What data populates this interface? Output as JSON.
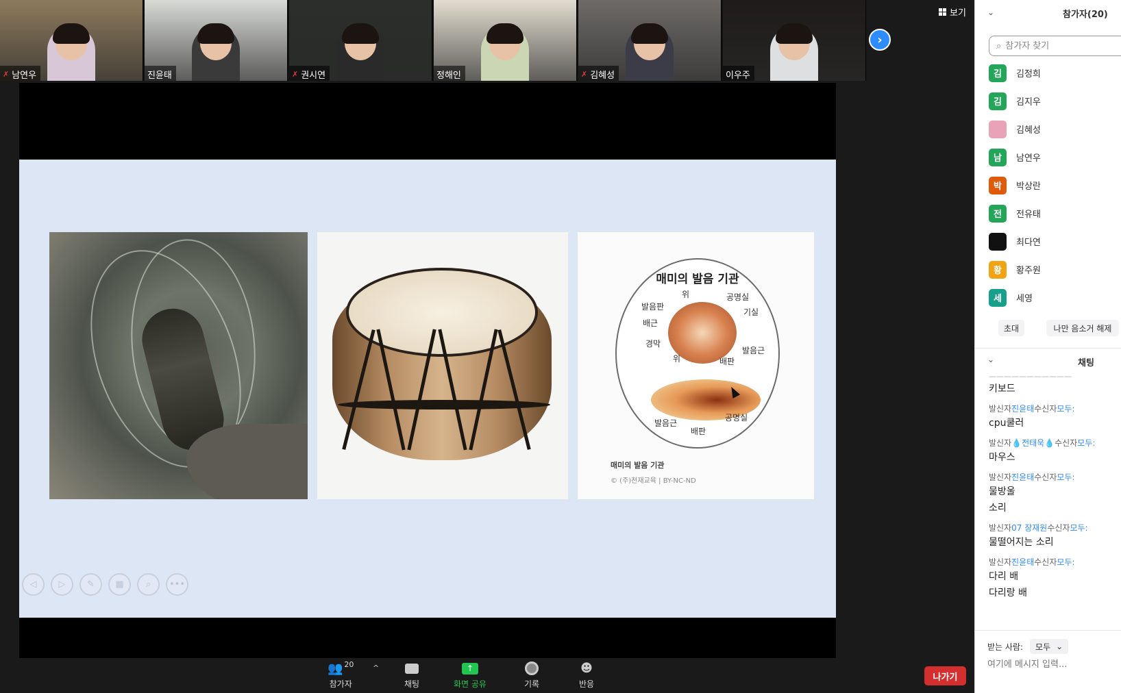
{
  "view": {
    "label": "보기"
  },
  "videos": [
    {
      "name": "남연우",
      "muted": true,
      "scene": "#8d7a5c",
      "shirt": "#d8c7d6"
    },
    {
      "name": "진윤태",
      "muted": false,
      "scene": "#d8dad6",
      "shirt": "#3a3a3a"
    },
    {
      "name": "권시연",
      "muted": true,
      "scene": "#2b2e2a",
      "shirt": "#2a2a2a"
    },
    {
      "name": "정해인",
      "muted": false,
      "scene": "#e2ddd0",
      "shirt": "#cbd7b4"
    },
    {
      "name": "김혜성",
      "muted": true,
      "scene": "#6d6a67",
      "shirt": "#3c3c48"
    },
    {
      "name": "이우주",
      "muted": false,
      "scene": "#1e1b19",
      "shirt": "#dedfe0"
    }
  ],
  "slide": {
    "diagram": {
      "title": "매미의 발음 기관",
      "labels": [
        "위",
        "공명실",
        "발음판",
        "기실",
        "배근",
        "경막",
        "발음근",
        "배판",
        "위",
        "발음근",
        "공명실",
        "배판"
      ],
      "caption": "매미의 발음 기관",
      "credit": "© (주)천재교육 | BY-NC-ND"
    },
    "controls": [
      "previous-icon",
      "next-icon",
      "pen-icon",
      "slides-icon",
      "zoom-icon",
      "more-icon"
    ]
  },
  "participants_panel": {
    "title": "참가자(20)",
    "search_placeholder": "참가자 찾기",
    "participants": [
      {
        "initial": "김",
        "name": "김정희",
        "color": "#23a55a"
      },
      {
        "initial": "김",
        "name": "김지우",
        "color": "#23a55a"
      },
      {
        "initial": "",
        "name": "김혜성",
        "color": "#e8a3b8"
      },
      {
        "initial": "남",
        "name": "남연우",
        "color": "#23a55a"
      },
      {
        "initial": "박",
        "name": "박상란",
        "color": "#e05a0c"
      },
      {
        "initial": "전",
        "name": "전유태",
        "color": "#23a55a"
      },
      {
        "initial": "",
        "name": "최다연",
        "color": "#111111"
      },
      {
        "initial": "황",
        "name": "황주원",
        "color": "#f0a314"
      },
      {
        "initial": "세",
        "name": "세영",
        "color": "#17a18a"
      }
    ],
    "invite_label": "초대",
    "unmute_me_label": "나만 음소거 해제"
  },
  "chat": {
    "title": "채팅",
    "messages": [
      {
        "sender": "",
        "lines": [
          "키보드"
        ]
      },
      {
        "sender": "진윤태",
        "lines": [
          "cpu쿨러"
        ]
      },
      {
        "sender": "💧전태욱💧",
        "lines": [
          "마우스"
        ]
      },
      {
        "sender": "진윤태",
        "lines": [
          "물방울",
          "소리"
        ]
      },
      {
        "sender": "07 장재원",
        "lines": [
          "물떨어지는 소리"
        ]
      },
      {
        "sender": "진윤태",
        "lines": [
          "다리 배",
          "다리랑 배"
        ]
      }
    ],
    "meta_from": "발신자",
    "meta_to": "수신자",
    "meta_everyone": "모두:",
    "to_label": "받는 사람:",
    "to_value": "모두",
    "input_placeholder": "여기에 메시지 입력..."
  },
  "toolbar": {
    "participants_label": "참가자",
    "participants_count": "20",
    "chat_label": "채팅",
    "share_label": "화면 공유",
    "record_label": "기록",
    "reactions_label": "반응",
    "leave_label": "나가기",
    "share_color": "#23c552"
  }
}
